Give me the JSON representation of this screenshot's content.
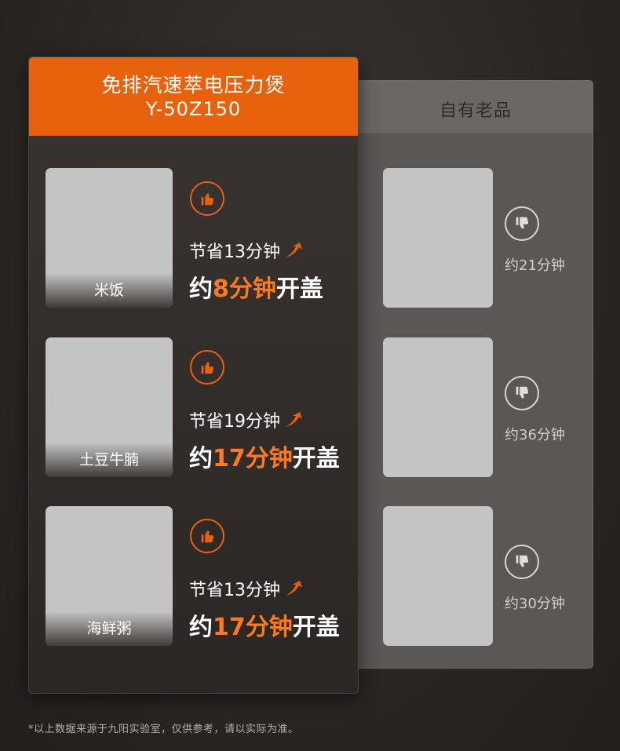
{
  "new_product": {
    "title": "免排汽速萃电压力煲",
    "model": "Y-50Z150"
  },
  "old_product": {
    "title": "自有老品"
  },
  "dishes": [
    {
      "name": "米饭",
      "saved": "节省13分钟",
      "open_prefix": "约",
      "open_time": "8分钟",
      "open_suffix": "开盖",
      "old_time": "约21分钟"
    },
    {
      "name": "土豆牛腩",
      "saved": "节省19分钟",
      "open_prefix": "约",
      "open_time": "17分钟",
      "open_suffix": "开盖",
      "old_time": "约36分钟"
    },
    {
      "name": "海鲜粥",
      "saved": "节省13分钟",
      "open_prefix": "约",
      "open_time": "17分钟",
      "open_suffix": "开盖",
      "old_time": "约30分钟"
    }
  ],
  "footnote": "*以上数据来源于九阳实验室，仅供参考，请以实际为准。",
  "colors": {
    "accent": "#e8620e",
    "highlight": "#ff7a1c",
    "panel_dark": "#2b2725",
    "panel_gray": "#5a5755"
  },
  "icons": {
    "like": "thumbs-up-icon",
    "dislike": "thumbs-down-icon",
    "up_arrow": "up-arrow-icon"
  }
}
